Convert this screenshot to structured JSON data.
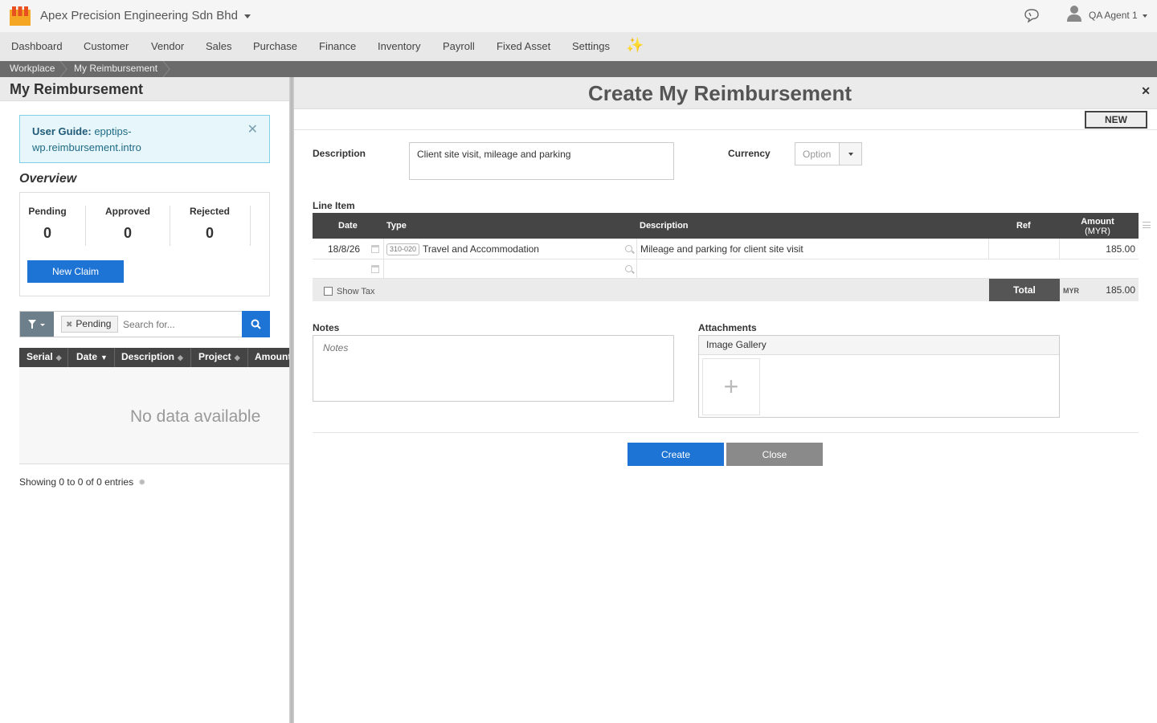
{
  "header": {
    "company": "Apex Precision Engineering Sdn Bhd",
    "user": "QA Agent 1"
  },
  "nav": [
    "Dashboard",
    "Customer",
    "Vendor",
    "Sales",
    "Purchase",
    "Finance",
    "Inventory",
    "Payroll",
    "Fixed Asset",
    "Settings"
  ],
  "breadcrumb": [
    "Workplace",
    "My Reimbursement"
  ],
  "left": {
    "title": "My Reimbursement",
    "guide_label": "User Guide:",
    "guide_link": "epptips-wp.reimbursement.intro",
    "overview_title": "Overview",
    "overview": [
      {
        "label": "Pending",
        "value": "0"
      },
      {
        "label": "Approved",
        "value": "0"
      },
      {
        "label": "Rejected",
        "value": "0"
      }
    ],
    "new_claim": "New Claim",
    "filter_chip": "Pending",
    "search_placeholder": "Search for...",
    "columns": [
      "Serial",
      "Date",
      "Description",
      "Project",
      "Amount"
    ],
    "no_data": "No data available",
    "showing": "Showing 0 to 0 of 0 entries"
  },
  "form": {
    "title": "Create My Reimbursement",
    "status": "NEW",
    "description_label": "Description",
    "description_value": "Client site visit, mileage and parking",
    "currency_label": "Currency",
    "currency_placeholder": "Option",
    "line_item_label": "Line Item",
    "line_columns": {
      "date": "Date",
      "type": "Type",
      "description": "Description",
      "ref": "Ref",
      "amount": "Amount",
      "amount_unit": "(MYR)"
    },
    "lines": [
      {
        "date": "18/8/26",
        "type_code": "310-020",
        "type": "Travel and Accommodation",
        "description": "Mileage and parking for client site visit",
        "ref": "",
        "amount": "185.00"
      }
    ],
    "show_tax": "Show Tax",
    "total_label": "Total",
    "total_currency": "MYR",
    "total_value": "185.00",
    "notes_label": "Notes",
    "notes_placeholder": "Notes",
    "attachments_label": "Attachments",
    "gallery_label": "Image Gallery",
    "add_symbol": "+",
    "create_button": "Create",
    "close_button": "Close"
  },
  "colors": {
    "primary": "#1d74d4",
    "header_dark": "#454545"
  }
}
